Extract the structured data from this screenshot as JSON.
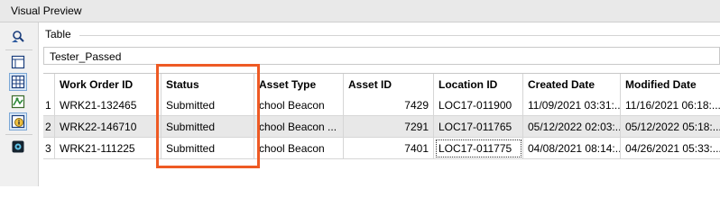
{
  "window": {
    "title": "Visual Preview"
  },
  "toolbar": {
    "icons": [
      "inspect-icon",
      "table-view-icon",
      "grid-icon",
      "graphics-view-icon",
      "info-icon",
      "3d-view-icon"
    ],
    "selected_color": "#dbe9f7"
  },
  "section": {
    "label": "Table"
  },
  "table_name": "Tester_Passed",
  "table": {
    "columns": [
      "Work Order ID",
      "Status",
      "Asset Type",
      "Asset ID",
      "Location ID",
      "Created Date",
      "Modified Date"
    ],
    "rows": [
      {
        "num": "1",
        "work_order_id": "WRK21-132465",
        "status": "Submitted",
        "asset_type": "chool Beacon",
        "asset_id": "7429",
        "location_id": "LOC17-011900",
        "created_date": "11/09/2021 03:31:...",
        "modified_date": "11/16/2021 06:18:..."
      },
      {
        "num": "2",
        "work_order_id": "WRK22-146710",
        "status": "Submitted",
        "asset_type": "chool Beacon ...",
        "asset_id": "7291",
        "location_id": "LOC17-011765",
        "created_date": "05/12/2022 02:03:...",
        "modified_date": "05/12/2022 05:18:..."
      },
      {
        "num": "3",
        "work_order_id": "WRK21-111225",
        "status": "Submitted",
        "asset_type": "chool Beacon",
        "asset_id": "7401",
        "location_id": "LOC17-011775",
        "created_date": "04/08/2021 08:14:...",
        "modified_date": "04/26/2021 05:33:..."
      }
    ]
  },
  "highlight": {
    "color": "#ee5a24"
  }
}
